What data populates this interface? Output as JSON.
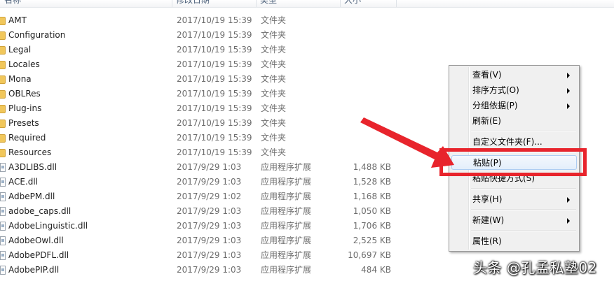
{
  "columns": {
    "name": "名称",
    "date": "修改日期",
    "type": "类型",
    "size": "大小"
  },
  "files": [
    {
      "name": "AMT",
      "date": "2017/10/19 15:39",
      "type": "文件夹",
      "size": "",
      "icon": "folder-icon"
    },
    {
      "name": "Configuration",
      "date": "2017/10/19 15:39",
      "type": "文件夹",
      "size": "",
      "icon": "folder-icon"
    },
    {
      "name": "Legal",
      "date": "2017/10/19 15:39",
      "type": "文件夹",
      "size": "",
      "icon": "folder-icon"
    },
    {
      "name": "Locales",
      "date": "2017/10/19 15:39",
      "type": "文件夹",
      "size": "",
      "icon": "folder-icon"
    },
    {
      "name": "Mona",
      "date": "2017/10/19 15:39",
      "type": "文件夹",
      "size": "",
      "icon": "folder-icon"
    },
    {
      "name": "OBLRes",
      "date": "2017/10/19 15:39",
      "type": "文件夹",
      "size": "",
      "icon": "folder-icon"
    },
    {
      "name": "Plug-ins",
      "date": "2017/10/19 15:39",
      "type": "文件夹",
      "size": "",
      "icon": "folder-icon"
    },
    {
      "name": "Presets",
      "date": "2017/10/19 15:39",
      "type": "文件夹",
      "size": "",
      "icon": "folder-icon"
    },
    {
      "name": "Required",
      "date": "2017/10/19 15:39",
      "type": "文件夹",
      "size": "",
      "icon": "folder-icon"
    },
    {
      "name": "Resources",
      "date": "2017/10/19 15:39",
      "type": "文件夹",
      "size": "",
      "icon": "folder-icon"
    },
    {
      "name": "A3DLIBS.dll",
      "date": "2017/9/29 1:03",
      "type": "应用程序扩展",
      "size": "1,488 KB",
      "icon": "dll-file-icon"
    },
    {
      "name": "ACE.dll",
      "date": "2017/9/29 1:03",
      "type": "应用程序扩展",
      "size": "1,528 KB",
      "icon": "dll-file-icon"
    },
    {
      "name": "AdbePM.dll",
      "date": "2017/9/29 1:02",
      "type": "应用程序扩展",
      "size": "1,168 KB",
      "icon": "dll-file-icon"
    },
    {
      "name": "adobe_caps.dll",
      "date": "2017/9/29 1:03",
      "type": "应用程序扩展",
      "size": "1,050 KB",
      "icon": "dll-file-icon"
    },
    {
      "name": "AdobeLinguistic.dll",
      "date": "2017/9/29 1:03",
      "type": "应用程序扩展",
      "size": "1,706 KB",
      "icon": "dll-file-icon"
    },
    {
      "name": "AdobeOwl.dll",
      "date": "2017/9/29 1:03",
      "type": "应用程序扩展",
      "size": "2,525 KB",
      "icon": "dll-file-icon"
    },
    {
      "name": "AdobePDFL.dll",
      "date": "2017/9/29 1:03",
      "type": "应用程序扩展",
      "size": "10,697 KB",
      "icon": "dll-file-icon"
    },
    {
      "name": "AdobePIP.dll",
      "date": "2017/9/29 1:03",
      "type": "应用程序扩展",
      "size": "484 KB",
      "icon": "dll-file-icon"
    }
  ],
  "context_menu": {
    "view": "查看(V)",
    "sort": "排序方式(O)",
    "group": "分组依据(P)",
    "refresh": "刷新(E)",
    "customize": "自定义文件夹(F)...",
    "paste": "粘贴(P)",
    "paste_shortcut": "粘贴快捷方式(S)",
    "share": "共享(H)",
    "new": "新建(W)",
    "properties": "属性(R)"
  },
  "annotation": {
    "color": "#e8242c"
  },
  "watermark": "头条 @孔孟私塾02"
}
